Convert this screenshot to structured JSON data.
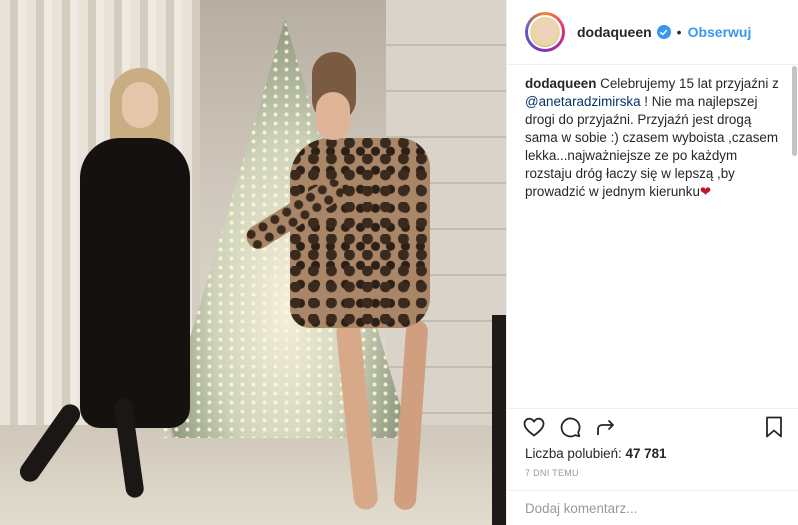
{
  "post": {
    "username": "dodaqueen",
    "separator": "•",
    "follow_label": "Obserwuj",
    "verified": true
  },
  "caption": {
    "username": "dodaqueen",
    "text_part1": "Celebrujemy 15 lat przyjaźni z",
    "mention": "@anetaradzimirska",
    "text_part2": "! Nie ma najlepszej drogi do przyjaźni. Przyjaźń jest drogą sama w sobie :) czasem wyboista ,czasem lekka...najważniejsze ze po każdym rozstaju dróg łaczy się w lepszą ,by prowadzić w jednym kierunku",
    "emoji": "❤"
  },
  "actions": {
    "like_icon": "heart-outline-icon",
    "comment_icon": "comment-icon",
    "share_icon": "share-icon",
    "save_icon": "bookmark-icon"
  },
  "likes": {
    "label": "Liczba polubień:",
    "count": "47 781"
  },
  "timestamp": "7 DNI TEMU",
  "comment": {
    "placeholder": "Dodaj komentarz..."
  },
  "colors": {
    "accent_blue": "#3897f0",
    "mention": "#003569",
    "heart": "#c0162c"
  }
}
